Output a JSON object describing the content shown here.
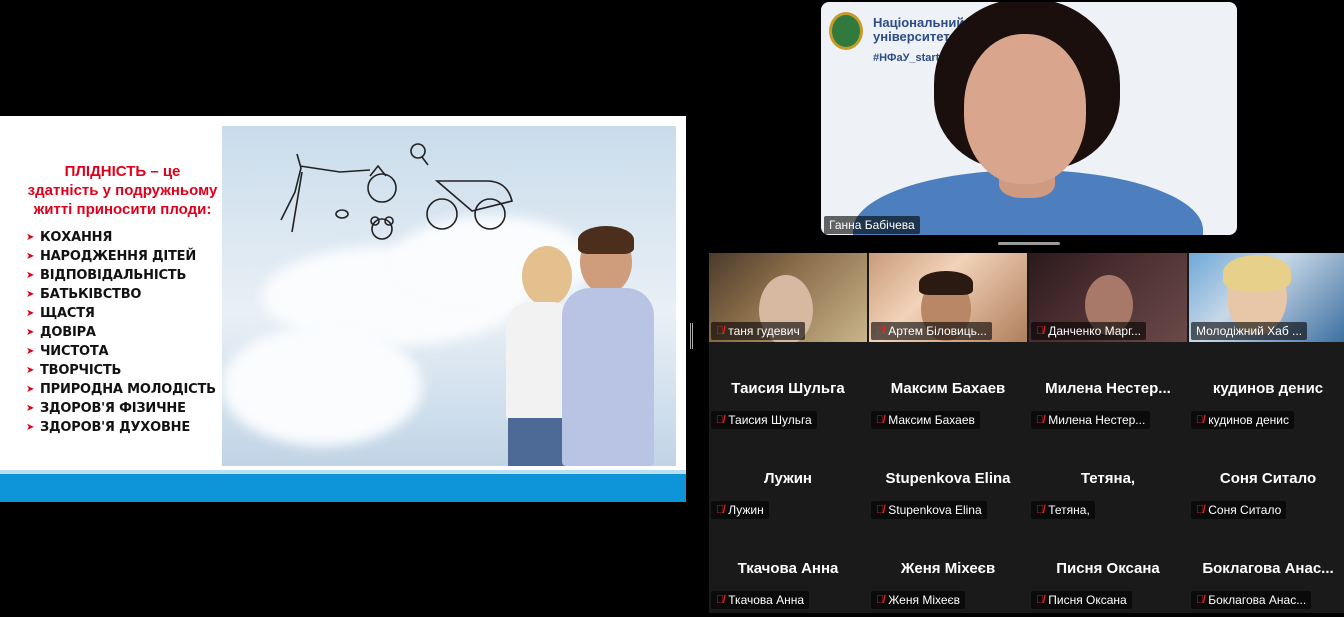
{
  "slide": {
    "title": "ПЛІДНІСТЬ – це",
    "subtitle": "здатність у подружньому житті приносити плоди:",
    "items": [
      "КОХАННЯ",
      "НАРОДЖЕННЯ ДІТЕЙ",
      "ВІДПОВІДАЛЬНІСТЬ",
      "БАТЬКІВСТВО",
      "ЩАСТЯ",
      "ДОВІРА",
      "ЧИСТОТА",
      "ТВОРЧІСТЬ",
      "ПРИРОДНА МОЛОДІСТЬ",
      "ЗДОРОВ'Я ФІЗИЧНЕ",
      "ЗДОРОВ'Я ДУХОВНЕ"
    ],
    "bullet": "➤"
  },
  "speaker": {
    "brand_line1": "Національний",
    "brand_line2": "університет",
    "hashtag": "#НФаУ_start",
    "name": "Ганна Бабічева"
  },
  "participants": [
    {
      "label": "таня гудевич",
      "video": true
    },
    {
      "label": "Артем Біловиць...",
      "video": true
    },
    {
      "label": "Данченко Марг...",
      "video": true
    },
    {
      "label": "Молодіжний Хаб ...",
      "video": true
    },
    {
      "label": "Таисия Шульга",
      "big": "Таисия Шульга"
    },
    {
      "label": "Максим Бахаев",
      "big": "Максим Бахаев"
    },
    {
      "label": "Милена Нестер...",
      "big": "Милена  Нестер..."
    },
    {
      "label": "кудинов денис",
      "big": "кудинов денис"
    },
    {
      "label": "Лужин",
      "big": "Лужин"
    },
    {
      "label": "Stupenkova Elina",
      "big": "Stupenkova Elina"
    },
    {
      "label": "Тетяна,",
      "big": "Тетяна,"
    },
    {
      "label": "Соня Ситало",
      "big": "Соня Ситало"
    },
    {
      "label": "Ткачова Анна",
      "big": "Ткачова Анна"
    },
    {
      "label": "Женя Міхеєв",
      "big": "Женя Міхеєв"
    },
    {
      "label": "Писня Оксана",
      "big": "Писня Оксана"
    },
    {
      "label": "Боклагова Анас...",
      "big": "Боклагова  Анас..."
    }
  ],
  "muted_icon": "mic-off-icon",
  "colors": {
    "slide_title": "#e0001b",
    "slide_band": "#0e94d8",
    "mic_off": "#e02b2b"
  }
}
